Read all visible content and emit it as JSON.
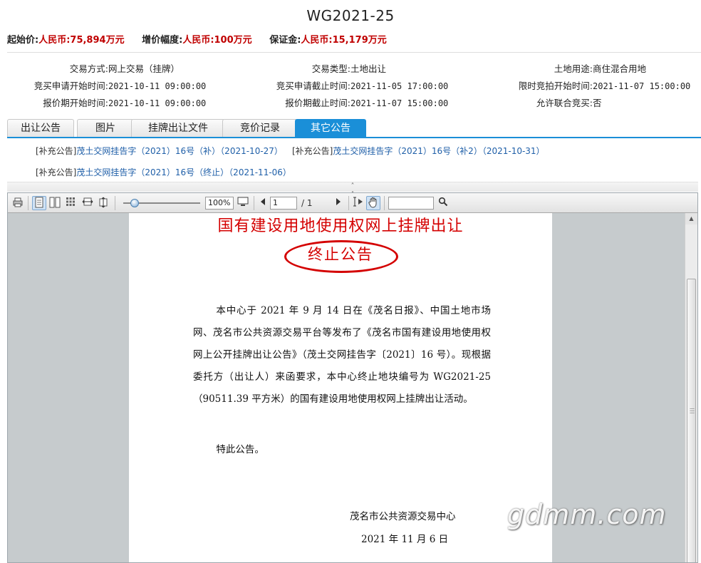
{
  "page": {
    "title": "WG2021-25"
  },
  "prices": {
    "start_label": "起始价:",
    "start_value": "人民币:75,894万元",
    "step_label": "增价幅度:",
    "step_value": "人民币:100万元",
    "deposit_label": "保证金:",
    "deposit_value": "人民币:15,179万元"
  },
  "info": {
    "row1": {
      "c1k": "交易方式:",
      "c1v": "网上交易（挂牌）",
      "c2k": "交易类型:",
      "c2v": "土地出让",
      "c3k": "土地用途:",
      "c3v": "商住混合用地"
    },
    "row2": {
      "c1k": "竞买申请开始时间:",
      "c1v": "2021-10-11 09:00:00",
      "c2k": "竞买申请截止时间:",
      "c2v": "2021-11-05 17:00:00",
      "c3k": "限时竞拍开始时间:",
      "c3v": "2021-11-07 15:00:00"
    },
    "row3": {
      "c1k": "报价期开始时间:",
      "c1v": "2021-10-11 09:00:00",
      "c2k": "报价期截止时间:",
      "c2v": "2021-11-07 15:00:00",
      "c3k": "允许联合竞买:",
      "c3v": "否"
    }
  },
  "tabs": [
    "出让公告",
    "图片",
    "挂牌出让文件",
    "竞价记录",
    "其它公告"
  ],
  "notices": [
    {
      "tag": "[补充公告]",
      "link": "茂土交网挂告字（2021）16号（补）（2021-10-27）"
    },
    {
      "tag": "[补充公告]",
      "link": "茂土交网挂告字（2021）16号（补2）（2021-10-31）"
    },
    {
      "tag": "[补充公告]",
      "link": "茂土交网挂告字（2021）16号（终止）（2021-11-06）"
    }
  ],
  "viewer": {
    "zoom": "100%",
    "page_current": "1",
    "page_total": "/ 1",
    "search_placeholder": ""
  },
  "doc": {
    "title": "国有建设用地使用权网上挂牌出让",
    "subtitle": "终止公告",
    "body": "本中心于 2021 年 9 月 14 日在《茂名日报》、中国土地市场网、茂名市公共资源交易平台等发布了《茂名市国有建设用地使用权网上公开挂牌出让公告》（茂土交网挂告字〔2021〕16 号）。现根据委托方（出让人）来函要求，本中心终止地块编号为 WG2021-25（90511.39 平方米）的国有建设用地使用权网上挂牌出让活动。",
    "closing": "特此公告。",
    "org": "茂名市公共资源交易中心",
    "date": "2021 年 11 月 6 日"
  },
  "watermark": "gdmm.com",
  "icons": [
    "print-icon",
    "single-page-icon",
    "two-page-icon",
    "thumbnails-icon",
    "fit-width-icon",
    "fit-height-icon",
    "fullscreen-icon",
    "prev-page-icon",
    "next-page-icon",
    "text-select-icon",
    "hand-tool-icon",
    "search-icon",
    "collapse-up-icon"
  ],
  "colors": {
    "accent": "#1a8fd8",
    "price_red": "#c00000",
    "doc_red": "#d40000",
    "link_blue": "#1f5fa8"
  }
}
